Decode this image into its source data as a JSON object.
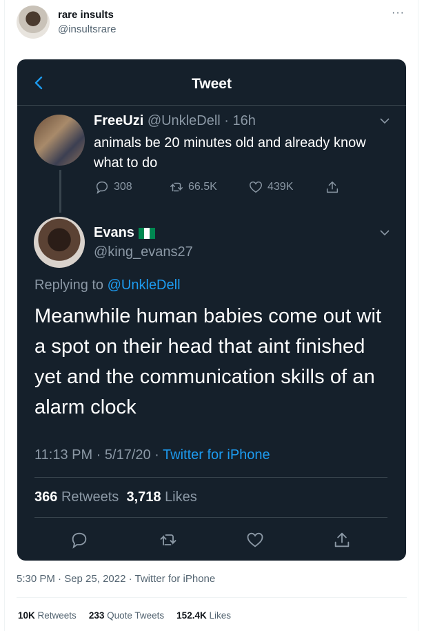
{
  "outer": {
    "display_name": "rare insults",
    "handle": "@insultsrare",
    "more": "···",
    "timestamp": "5:30 PM · Sep 25, 2022 · Twitter for iPhone",
    "retweets_count": "10K",
    "retweets_label": "Retweets",
    "quotes_count": "233",
    "quotes_label": "Quote Tweets",
    "likes_count": "152.4K",
    "likes_label": "Likes"
  },
  "screenshot": {
    "header_title": "Tweet",
    "parent_tweet": {
      "display_name": "FreeUzi",
      "handle": "@UnkleDell",
      "time": " · 16h",
      "text": "animals be 20 minutes old and already know what to do",
      "replies": "308",
      "retweets": "66.5K",
      "likes": "439K"
    },
    "main_tweet": {
      "display_name": "Evans",
      "handle": "@king_evans27",
      "replying_to_prefix": "Replying to ",
      "replying_to_handle": "@UnkleDell",
      "text": "Meanwhile human babies come out wit a spot on their head that aint finished yet and the communication skills of an alarm clock",
      "time": "11:13 PM · 5/17/20 · ",
      "source": "Twitter for iPhone",
      "retweets_count": "366",
      "retweets_label": "Retweets",
      "likes_count": "3,718",
      "likes_label": "Likes"
    }
  },
  "colors": {
    "dark_bg": "#15202b",
    "accent": "#1d9bf0",
    "muted_dark": "#8b98a5",
    "muted_light": "#536471"
  }
}
